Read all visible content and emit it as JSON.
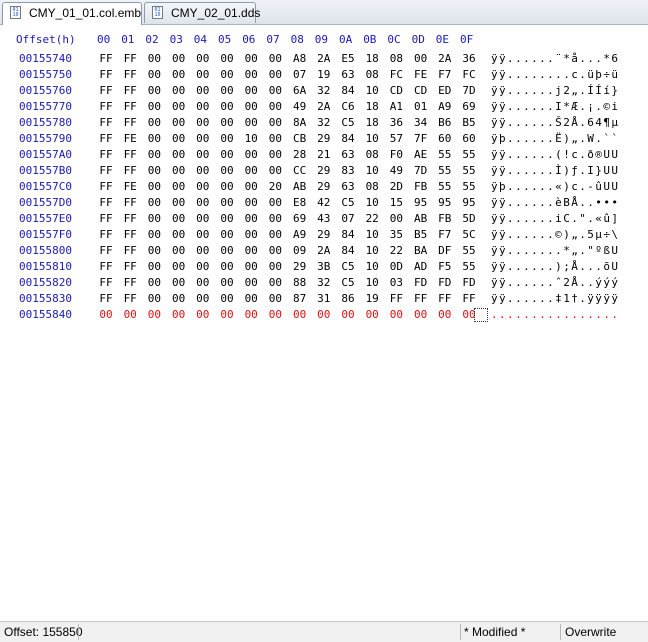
{
  "tabs": [
    {
      "label": "CMY_01_01.col.emb",
      "active": true
    },
    {
      "label": "CMY_02_01.dds",
      "active": false
    }
  ],
  "header": {
    "offset_label": "Offset(h)",
    "columns": [
      "00",
      "01",
      "02",
      "03",
      "04",
      "05",
      "06",
      "07",
      "08",
      "09",
      "0A",
      "0B",
      "0C",
      "0D",
      "0E",
      "0F"
    ]
  },
  "rows": [
    {
      "offset": "00155740",
      "bytes": [
        "FF",
        "FF",
        "00",
        "00",
        "00",
        "00",
        "00",
        "00",
        "A8",
        "2A",
        "E5",
        "18",
        "08",
        "00",
        "2A",
        "36"
      ],
      "ascii": "ÿÿ......¨*å...*6"
    },
    {
      "offset": "00155750",
      "bytes": [
        "FF",
        "FF",
        "00",
        "00",
        "00",
        "00",
        "00",
        "00",
        "07",
        "19",
        "63",
        "08",
        "FC",
        "FE",
        "F7",
        "FC"
      ],
      "ascii": "ÿÿ........c.üþ÷ü"
    },
    {
      "offset": "00155760",
      "bytes": [
        "FF",
        "FF",
        "00",
        "00",
        "00",
        "00",
        "00",
        "00",
        "6A",
        "32",
        "84",
        "10",
        "CD",
        "CD",
        "ED",
        "7D"
      ],
      "ascii": "ÿÿ......j2„.ÍÍí}"
    },
    {
      "offset": "00155770",
      "bytes": [
        "FF",
        "FF",
        "00",
        "00",
        "00",
        "00",
        "00",
        "00",
        "49",
        "2A",
        "C6",
        "18",
        "A1",
        "01",
        "A9",
        "69"
      ],
      "ascii": "ÿÿ......I*Æ.¡.©i"
    },
    {
      "offset": "00155780",
      "bytes": [
        "FF",
        "FF",
        "00",
        "00",
        "00",
        "00",
        "00",
        "00",
        "8A",
        "32",
        "C5",
        "18",
        "36",
        "34",
        "B6",
        "B5"
      ],
      "ascii": "ÿÿ......Š2Å.64¶µ"
    },
    {
      "offset": "00155790",
      "bytes": [
        "FF",
        "FE",
        "00",
        "00",
        "00",
        "00",
        "10",
        "00",
        "CB",
        "29",
        "84",
        "10",
        "57",
        "7F",
        "60",
        "60"
      ],
      "ascii": "ÿþ......Ë)„.W.``"
    },
    {
      "offset": "001557A0",
      "bytes": [
        "FF",
        "FF",
        "00",
        "00",
        "00",
        "00",
        "00",
        "00",
        "28",
        "21",
        "63",
        "08",
        "F0",
        "AE",
        "55",
        "55"
      ],
      "ascii": "ÿÿ......(!c.ð®UU"
    },
    {
      "offset": "001557B0",
      "bytes": [
        "FF",
        "FF",
        "00",
        "00",
        "00",
        "00",
        "00",
        "00",
        "CC",
        "29",
        "83",
        "10",
        "49",
        "7D",
        "55",
        "55"
      ],
      "ascii": "ÿÿ......Ì)ƒ.I}UU"
    },
    {
      "offset": "001557C0",
      "bytes": [
        "FF",
        "FE",
        "00",
        "00",
        "00",
        "00",
        "00",
        "20",
        "AB",
        "29",
        "63",
        "08",
        "2D",
        "FB",
        "55",
        "55"
      ],
      "ascii": "ÿþ......«)c.-ûUU"
    },
    {
      "offset": "001557D0",
      "bytes": [
        "FF",
        "FF",
        "00",
        "00",
        "00",
        "00",
        "00",
        "00",
        "E8",
        "42",
        "C5",
        "10",
        "15",
        "95",
        "95",
        "95"
      ],
      "ascii": "ÿÿ......èBÅ..•••"
    },
    {
      "offset": "001557E0",
      "bytes": [
        "FF",
        "FF",
        "00",
        "00",
        "00",
        "00",
        "00",
        "00",
        "69",
        "43",
        "07",
        "22",
        "00",
        "AB",
        "FB",
        "5D"
      ],
      "ascii": "ÿÿ......iC.\".«û]"
    },
    {
      "offset": "001557F0",
      "bytes": [
        "FF",
        "FF",
        "00",
        "00",
        "00",
        "00",
        "00",
        "00",
        "A9",
        "29",
        "84",
        "10",
        "35",
        "B5",
        "F7",
        "5C"
      ],
      "ascii": "ÿÿ......©)„.5µ÷\\"
    },
    {
      "offset": "00155800",
      "bytes": [
        "FF",
        "FF",
        "00",
        "00",
        "00",
        "00",
        "00",
        "00",
        "09",
        "2A",
        "84",
        "10",
        "22",
        "BA",
        "DF",
        "55"
      ],
      "ascii": "ÿÿ.......*„.\"ºßU"
    },
    {
      "offset": "00155810",
      "bytes": [
        "FF",
        "FF",
        "00",
        "00",
        "00",
        "00",
        "00",
        "00",
        "29",
        "3B",
        "C5",
        "10",
        "0D",
        "AD",
        "F5",
        "55"
      ],
      "ascii": "ÿÿ......);Å...õU"
    },
    {
      "offset": "00155820",
      "bytes": [
        "FF",
        "FF",
        "00",
        "00",
        "00",
        "00",
        "00",
        "00",
        "88",
        "32",
        "C5",
        "10",
        "03",
        "FD",
        "FD",
        "FD"
      ],
      "ascii": "ÿÿ......ˆ2Å..ýýý"
    },
    {
      "offset": "00155830",
      "bytes": [
        "FF",
        "FF",
        "00",
        "00",
        "00",
        "00",
        "00",
        "00",
        "87",
        "31",
        "86",
        "19",
        "FF",
        "FF",
        "FF",
        "FF"
      ],
      "ascii": "ÿÿ......‡1†.ÿÿÿÿ"
    },
    {
      "offset": "00155840",
      "bytes": [
        "00",
        "00",
        "00",
        "00",
        "00",
        "00",
        "00",
        "00",
        "00",
        "00",
        "00",
        "00",
        "00",
        "00",
        "00",
        "00"
      ],
      "ascii": "................",
      "new": true
    }
  ],
  "status": {
    "offset_text": "Offset: 155850",
    "modified_text": "* Modified *",
    "mode_text": "Overwrite"
  },
  "colors": {
    "offset_blue": "#1a1ab0",
    "new_data_red": "#e01010"
  },
  "icons": {
    "tab_file": "hex-file-icon"
  }
}
